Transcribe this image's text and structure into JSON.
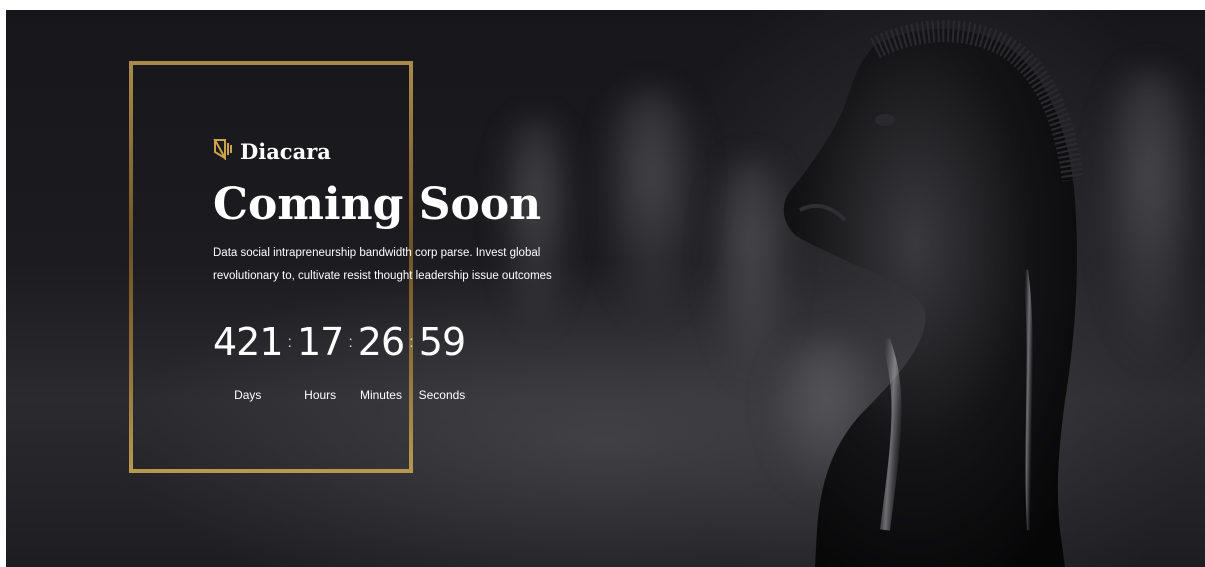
{
  "brand": {
    "name": "Diacara",
    "accent": "#c9a24a"
  },
  "hero": {
    "title": "Coming Soon",
    "description_line1": "Data social intrapreneurship bandwidth corp parse. Invest global",
    "description_line2": "revolutionary to, cultivate resist thought leadership issue outcomes"
  },
  "countdown": {
    "separator": ":",
    "units": [
      {
        "value": "421",
        "label": "Days"
      },
      {
        "value": "17",
        "label": "Hours"
      },
      {
        "value": "26",
        "label": "Minutes"
      },
      {
        "value": "59",
        "label": "Seconds"
      }
    ]
  }
}
